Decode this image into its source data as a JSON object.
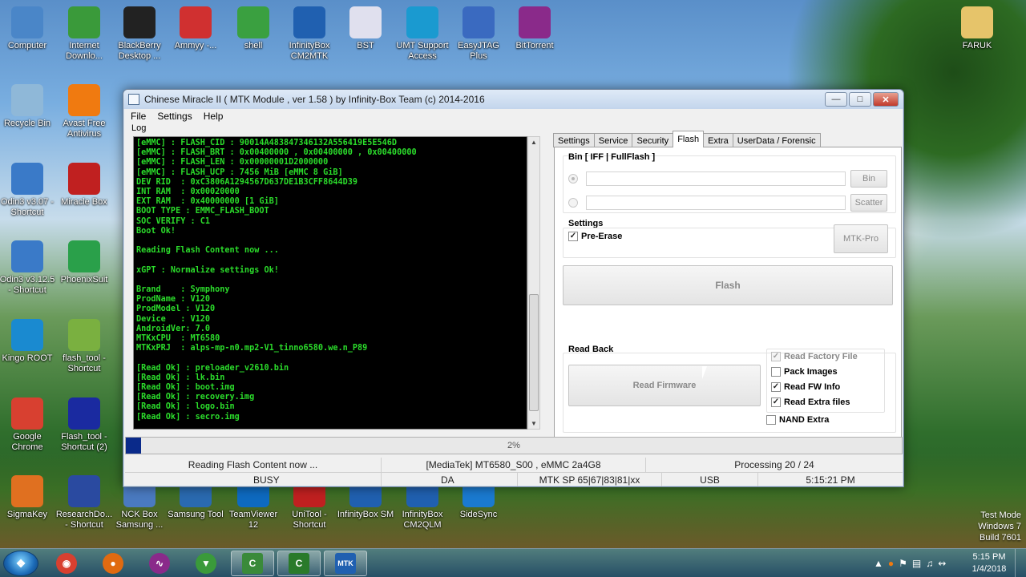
{
  "desktop": {
    "icons": [
      {
        "label": "Computer",
        "icon": "computer-icon",
        "color": "#4a86c8"
      },
      {
        "label": "Internet Downlo...",
        "icon": "idm-icon",
        "color": "#3a9a3a"
      },
      {
        "label": "BlackBerry Desktop ...",
        "icon": "blackberry-icon",
        "color": "#222222"
      },
      {
        "label": "Ammyy -...",
        "icon": "ammyy-icon",
        "color": "#d03030"
      },
      {
        "label": "shell",
        "icon": "shell-icon",
        "color": "#3aa040"
      },
      {
        "label": "InfinityBox CM2MTK",
        "icon": "infinitybox-icon",
        "color": "#2060b0"
      },
      {
        "label": "BST",
        "icon": "bst-icon",
        "color": "#e0e0ee"
      },
      {
        "label": "UMT Support Access",
        "icon": "umt-icon",
        "color": "#1a9ad0"
      },
      {
        "label": "EasyJTAG Plus",
        "icon": "easyjtag-icon",
        "color": "#3a6ac0"
      },
      {
        "label": "BitTorrent",
        "icon": "bittorrent-icon",
        "color": "#8a2a8a"
      },
      {
        "label": "FARUK",
        "icon": "folder-icon",
        "color": "#e6c46a"
      },
      {
        "label": "Recycle Bin",
        "icon": "recycle-bin-icon",
        "color": "#8fb8d8"
      },
      {
        "label": "Avast Free Antivirus",
        "icon": "avast-icon",
        "color": "#f07a10"
      },
      {
        "label": "Odin3 v3.07 - Shortcut",
        "icon": "odin-icon",
        "color": "#3a7ac8"
      },
      {
        "label": "Miracle Box",
        "icon": "miraclebox-icon",
        "color": "#c02020"
      },
      {
        "label": "Odin3 v3.12.5 - Shortcut",
        "icon": "odin-icon",
        "color": "#3a7ac8"
      },
      {
        "label": "PhoenixSuit",
        "icon": "phoenixsuit-icon",
        "color": "#2aa04a"
      },
      {
        "label": "Kingo ROOT",
        "icon": "kingo-icon",
        "color": "#1a8ad0"
      },
      {
        "label": "flash_tool - Shortcut",
        "icon": "android-icon",
        "color": "#7ab040"
      },
      {
        "label": "Google Chrome",
        "icon": "chrome-icon",
        "color": "#d84030"
      },
      {
        "label": "Flash_tool - Shortcut (2)",
        "icon": "flashtool-icon",
        "color": "#1a2aa0"
      },
      {
        "label": "SigmaKey",
        "icon": "sigmakey-icon",
        "color": "#e07020"
      },
      {
        "label": "ResearchDo... - Shortcut",
        "icon": "researchdownload-icon",
        "color": "#2a4aa0"
      },
      {
        "label": "NCK Box Samsung ...",
        "icon": "nck-icon",
        "color": "#4a7ac0"
      },
      {
        "label": "Samsung Tool",
        "icon": "samsung-tool-icon",
        "color": "#2a6ab0"
      },
      {
        "label": "TeamViewer 12",
        "icon": "teamviewer-icon",
        "color": "#0e6ac0"
      },
      {
        "label": "UniTool - Shortcut",
        "icon": "unitool-icon",
        "color": "#c02020"
      },
      {
        "label": "InfinityBox SM",
        "icon": "infinitybox-icon",
        "color": "#2060b0"
      },
      {
        "label": "InfinityBox CM2QLM",
        "icon": "infinitybox-icon",
        "color": "#2060b0"
      },
      {
        "label": "SideSync",
        "icon": "sidesync-icon",
        "color": "#1a7ad0"
      }
    ],
    "watermark": [
      "Test Mode",
      "Windows 7",
      "Build 7601"
    ]
  },
  "window": {
    "title": "Chinese Miracle II ( MTK Module , ver 1.58 ) by Infinity-Box Team (c) 2014-2016",
    "menu": [
      "File",
      "Settings",
      "Help"
    ],
    "log_label": "Log",
    "log_lines": [
      "[eMMC] : FLASH_CID : 90014A483847346132A556419E5E546D",
      "[eMMC] : FLASH_BRT : 0x00400000 , 0x00400000 , 0x00400000",
      "[eMMC] : FLASH_LEN : 0x00000001D2000000",
      "[eMMC] : FLASH_UCP : 7456 MiB [eMMC 8 GiB]",
      "DEV RID  : 0xC3806A1294567D637DE1B3CFF8644D39",
      "INT RAM  : 0x00020000",
      "EXT RAM  : 0x40000000 [1 GiB]",
      "BOOT TYPE : EMMC_FLASH_BOOT",
      "SOC VERIFY : C1",
      "Boot Ok!",
      "",
      "Reading Flash Content now ...",
      "",
      "xGPT : Normalize settings Ok!",
      "",
      "Brand    : Symphony",
      "ProdName : V120",
      "ProdModel : V120",
      "Device   : V120",
      "AndroidVer: 7.0",
      "MTKxCPU  : MT6580",
      "MTKxPRJ  : alps-mp-n0.mp2-V1_tinno6580.we.n_P89",
      "",
      "[Read Ok] : preloader_v2610.bin",
      "[Read Ok] : lk.bin",
      "[Read Ok] : boot.img",
      "[Read Ok] : recovery.img",
      "[Read Ok] : logo.bin",
      "[Read Ok] : secro.img"
    ],
    "tabs": [
      "Settings",
      "Service",
      "Security",
      "Flash",
      "Extra",
      "UserData / Forensic"
    ],
    "active_tab": "Flash",
    "flash": {
      "bin_group_label": "Bin  [ IFF | FullFlash ]",
      "bin_button": "Bin",
      "scatter_button": "Scatter",
      "settings_label": "Settings",
      "pre_erase_label": "Pre-Erase",
      "pre_erase_checked": true,
      "mtk_pro_button": "MTK-Pro",
      "flash_button": "Flash",
      "read_back_label": "Read Back",
      "read_firmware_button": "Read Firmware",
      "read_factory_file_label": "Read Factory File",
      "pack_images_label": "Pack Images",
      "read_fw_info_label": "Read FW Info",
      "read_extra_files_label": "Read Extra files",
      "nand_extra_label": "NAND Extra"
    },
    "progress": {
      "percent": 2,
      "label": "2%",
      "fill_color": "#0a2a8a"
    },
    "status1": [
      "Reading Flash Content now ...",
      "[MediaTek] MT6580_S00 , eMMC 2a4G8",
      "Processing 20 / 24"
    ],
    "status2": [
      "BUSY",
      "DA",
      "MTK SP 65|67|83|81|xx",
      "USB",
      "5:15:21 PM"
    ]
  },
  "taskbar": {
    "clock_time": "5:15 PM",
    "clock_date": "1/4/2018"
  }
}
